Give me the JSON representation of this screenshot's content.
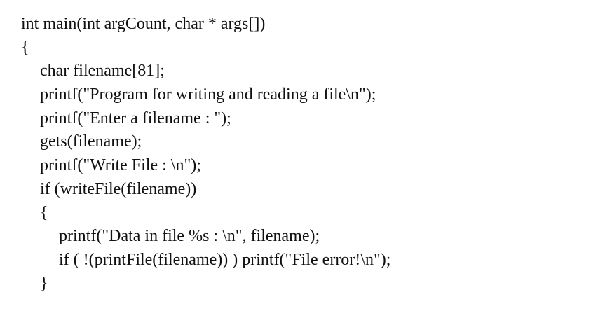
{
  "code": {
    "lines": [
      {
        "text": "int main(int argCount, char * args[])",
        "indent": 0
      },
      {
        "text": "{",
        "indent": 0
      },
      {
        "text": "char filename[81];",
        "indent": 1
      },
      {
        "text": "printf(\"Program for writing and reading a file\\n\");",
        "indent": 1
      },
      {
        "text": "printf(\"Enter a filename : \");",
        "indent": 1
      },
      {
        "text": "gets(filename);",
        "indent": 1
      },
      {
        "text": "printf(\"Write File : \\n\");",
        "indent": 1
      },
      {
        "text": "if (writeFile(filename))",
        "indent": 1
      },
      {
        "text": "{",
        "indent": 1
      },
      {
        "text": "printf(\"Data in file %s : \\n\", filename);",
        "indent": 2
      },
      {
        "text": "if ( !(printFile(filename)) ) printf(\"File error!\\n\");",
        "indent": 2
      },
      {
        "text": "}",
        "indent": 1
      }
    ]
  }
}
